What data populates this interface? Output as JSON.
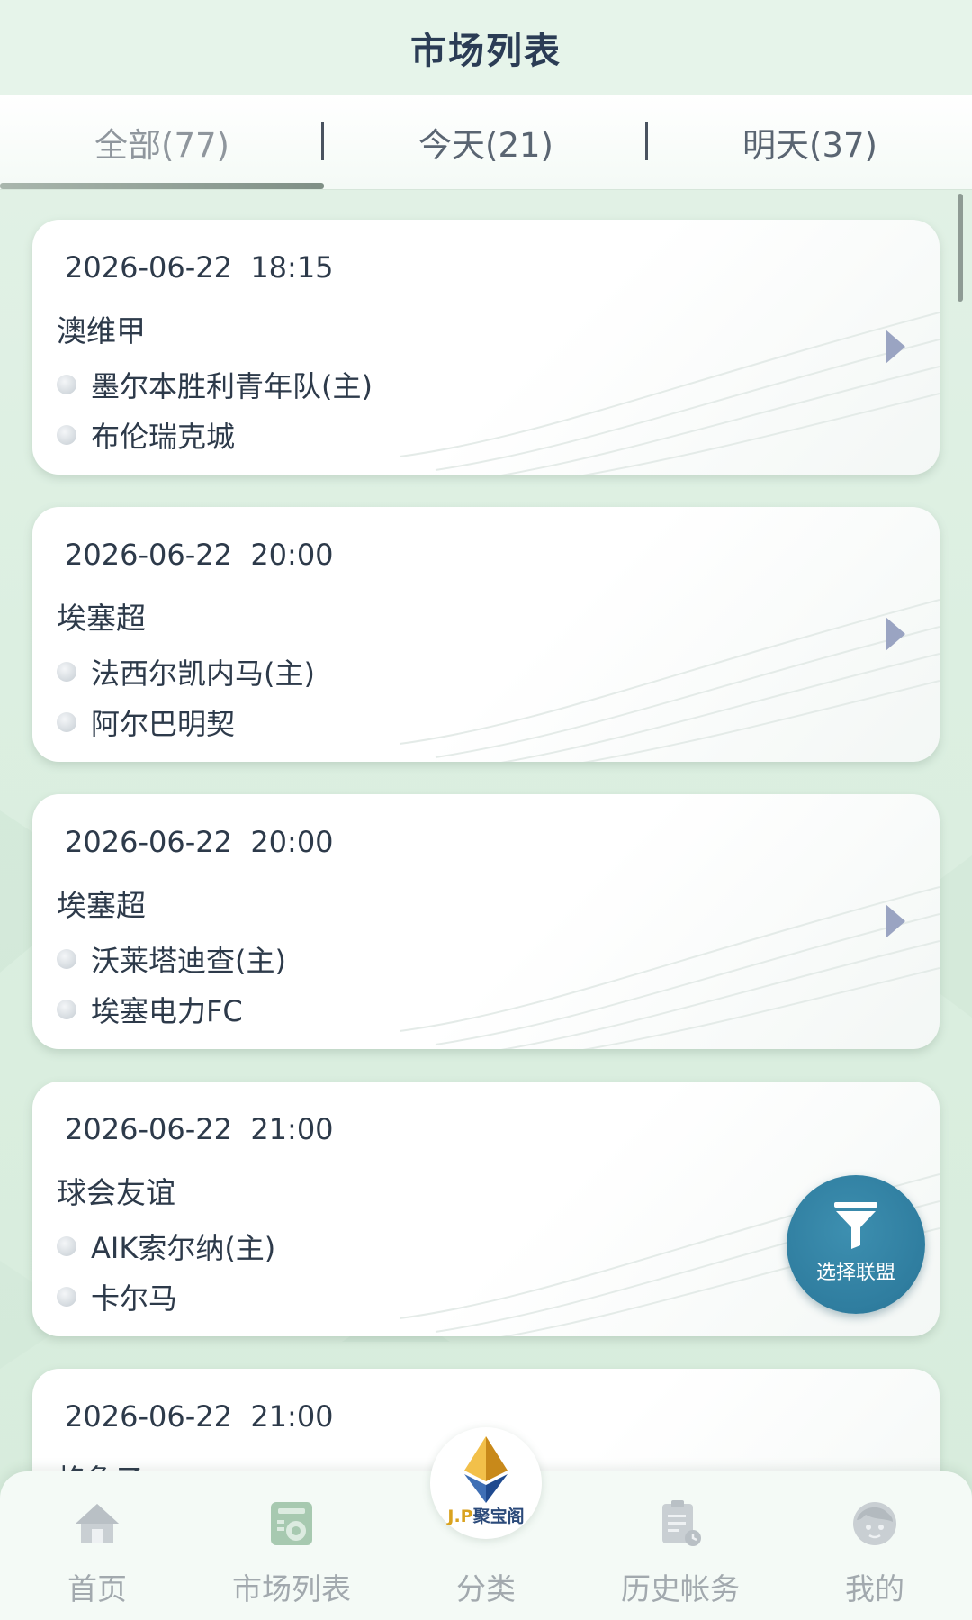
{
  "header": {
    "title": "市场列表"
  },
  "tabs": [
    {
      "label": "全部(77)",
      "active": true
    },
    {
      "label": "今天(21)",
      "active": false
    },
    {
      "label": "明天(37)",
      "active": false
    }
  ],
  "matches": [
    {
      "datetime": "2026-06-22  18:15",
      "league": "澳维甲",
      "home": "墨尔本胜利青年队(主)",
      "away": "布伦瑞克城"
    },
    {
      "datetime": "2026-06-22  20:00",
      "league": "埃塞超",
      "home": "法西尔凯内马(主)",
      "away": "阿尔巴明契"
    },
    {
      "datetime": "2026-06-22  20:00",
      "league": "埃塞超",
      "home": "沃莱塔迪查(主)",
      "away": "埃塞电力FC"
    },
    {
      "datetime": "2026-06-22  21:00",
      "league": "球会友谊",
      "home": "AIK索尔纳(主)",
      "away": "卡尔马"
    },
    {
      "datetime": "2026-06-22  21:00",
      "league": "格鲁乙",
      "home": "",
      "away": ""
    }
  ],
  "filter_button": {
    "label": "选择联盟",
    "icon": "filter-funnel-icon"
  },
  "bottom_nav": {
    "items": [
      {
        "label": "首页",
        "icon": "home-icon"
      },
      {
        "label": "市场列表",
        "icon": "market-list-icon"
      },
      {
        "label": "分类",
        "icon": "category-logo-icon"
      },
      {
        "label": "历史帐务",
        "icon": "history-ledger-icon"
      },
      {
        "label": "我的",
        "icon": "profile-face-icon"
      }
    ],
    "center_logo": {
      "brand_prefix": "J.P",
      "brand_name": "聚宝阁"
    }
  },
  "colors": {
    "background": "#dcefe1",
    "header_title": "#2b3c55",
    "fab": "#2f7d9f",
    "arrow": "#9aa4c2",
    "nav_label": "#a2a9ae",
    "logo_gold": "#d9a21f"
  }
}
